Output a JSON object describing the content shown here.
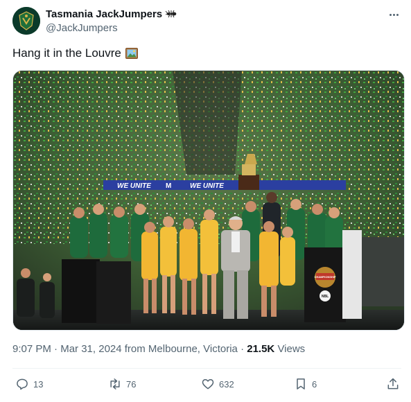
{
  "author": {
    "display_name": "Tasmania JackJumpers",
    "handle": "@JackJumpers",
    "badge_icon": "ant-icon",
    "avatar_icon": "jackjumpers-logo"
  },
  "tweet": {
    "text": "Hang it in the Louvre",
    "emoji_icon": "framed-picture-icon"
  },
  "media": {
    "banner_text_1": "WE UNITE",
    "banner_text_2": "WE UNITE",
    "banner_letter": "M",
    "podium_label": "NBL",
    "podium_sign": "CHAMPIONSHIP"
  },
  "meta": {
    "time": "9:07 PM",
    "separator": "·",
    "date": "Mar 31, 2024",
    "location": "from Melbourne, Victoria",
    "views_count": "21.5K",
    "views_label": "Views"
  },
  "actions": {
    "replies": "13",
    "reposts": "76",
    "likes": "632",
    "bookmarks": "6"
  },
  "colors": {
    "text": "#0f1419",
    "secondary": "#536471",
    "divider": "#eff3f4",
    "brand_green": "#0b3a2a"
  }
}
